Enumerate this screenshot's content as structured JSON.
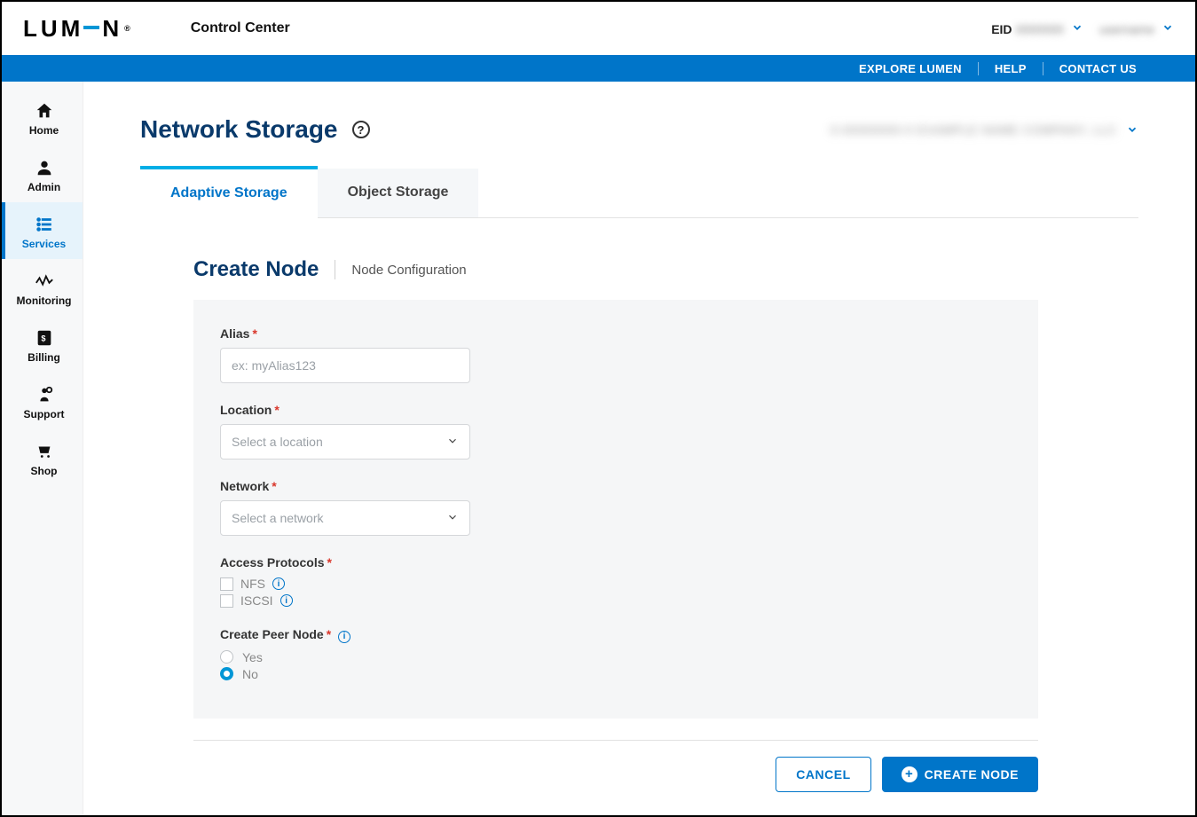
{
  "brand": "LUMEN",
  "app_title": "Control Center",
  "header": {
    "eid_label": "EID",
    "eid_value": "0000000",
    "user_value": "username"
  },
  "linkbar": {
    "explore": "EXPLORE LUMEN",
    "help": "HELP",
    "contact": "CONTACT US"
  },
  "sidebar": {
    "home": "Home",
    "admin": "Admin",
    "services": "Services",
    "monitoring": "Monitoring",
    "billing": "Billing",
    "support": "Support",
    "shop": "Shop"
  },
  "page": {
    "title": "Network Storage",
    "account_text": "0-00000000-0 EXAMPLE NAME COMPANY, LLC"
  },
  "tabs": {
    "adaptive": "Adaptive Storage",
    "object": "Object Storage"
  },
  "section": {
    "title": "Create Node",
    "crumb": "Node Configuration"
  },
  "form": {
    "alias_label": "Alias",
    "alias_placeholder": "ex: myAlias123",
    "location_label": "Location",
    "location_placeholder": "Select a location",
    "network_label": "Network",
    "network_placeholder": "Select a network",
    "protocols_label": "Access Protocols",
    "protocol_nfs": "NFS",
    "protocol_iscsi": "ISCSI",
    "peer_label": "Create Peer Node",
    "peer_yes": "Yes",
    "peer_no": "No"
  },
  "buttons": {
    "cancel": "CANCEL",
    "create": "CREATE NODE"
  }
}
